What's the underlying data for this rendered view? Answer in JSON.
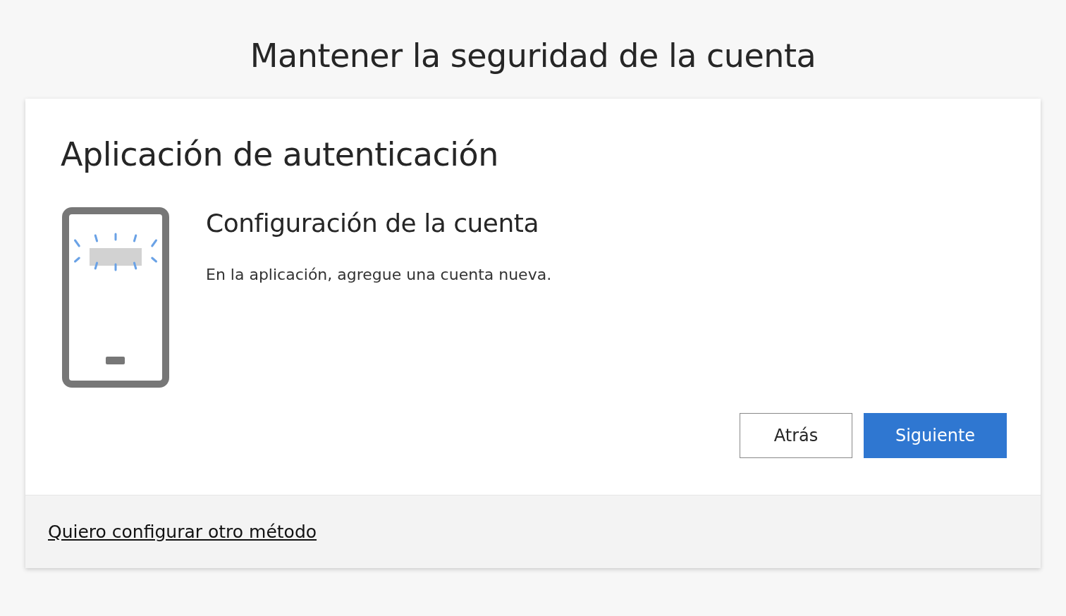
{
  "page_title": "Mantener la seguridad de la cuenta",
  "card": {
    "heading": "Aplicación de autenticación",
    "step_title": "Configuración de la cuenta",
    "instruction": "En la aplicación, agregue una cuenta nueva.",
    "buttons": [
      {
        "label": "Atrás",
        "kind": "secondary"
      },
      {
        "label": "Siguiente",
        "kind": "primary"
      }
    ]
  },
  "footer": {
    "link": "Quiero configurar otro método"
  }
}
